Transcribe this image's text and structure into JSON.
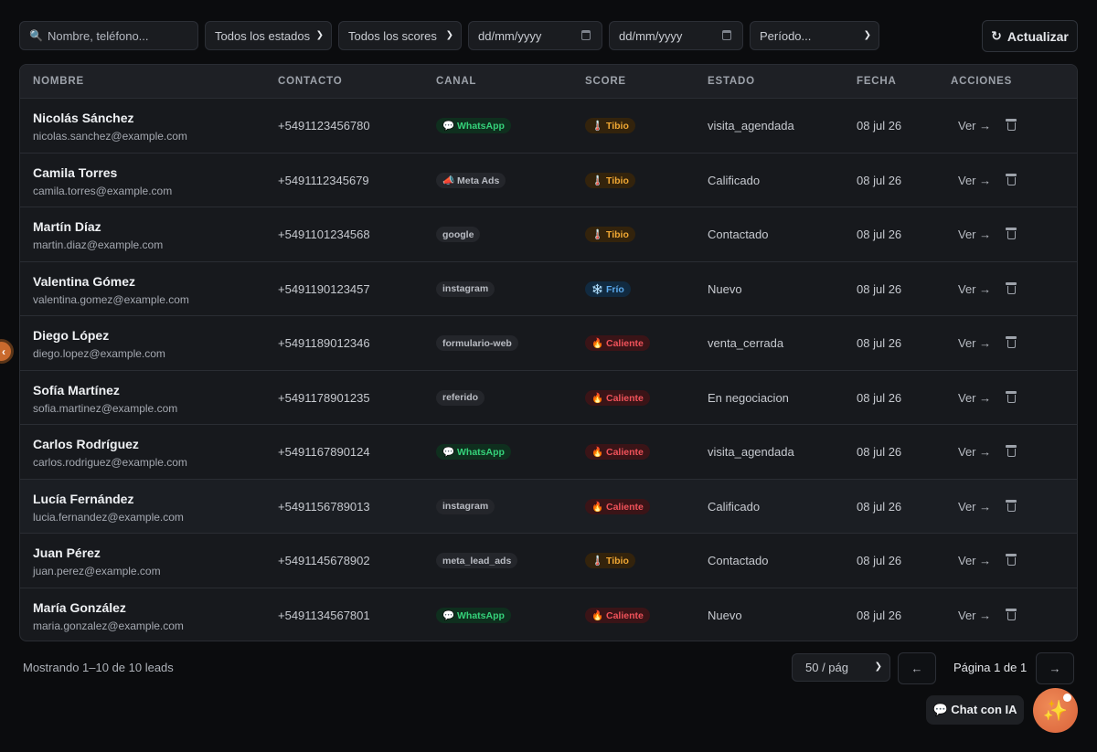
{
  "filters": {
    "search_placeholder": "Nombre, teléfono...",
    "estado": "Todos los estados",
    "score": "Todos los scores",
    "date_from_placeholder": "dd/mm/yyyy",
    "date_to_placeholder": "dd/mm/yyyy",
    "periodo": "Período...",
    "refresh_label": "Actualizar"
  },
  "table": {
    "headers": {
      "nombre": "NOMBRE",
      "contacto": "CONTACTO",
      "canal": "CANAL",
      "score": "SCORE",
      "estado": "ESTADO",
      "fecha": "FECHA",
      "acciones": "ACCIONES"
    },
    "rows": [
      {
        "name": "Nicolás Sánchez",
        "email": "nicolas.sanchez@example.com",
        "phone": "+5491123456780",
        "canal": "💬 WhatsApp",
        "canal_type": "wa",
        "score": "🌡️ Tibio",
        "score_type": "tibio",
        "estado": "visita_agendada",
        "fecha": "08 jul 26",
        "ver": "Ver →"
      },
      {
        "name": "Camila Torres",
        "email": "camila.torres@example.com",
        "phone": "+5491112345679",
        "canal": "📣 Meta Ads",
        "canal_type": "meta",
        "score": "🌡️ Tibio",
        "score_type": "tibio",
        "estado": "Calificado",
        "fecha": "08 jul 26",
        "ver": "Ver →"
      },
      {
        "name": "Martín Díaz",
        "email": "martin.diaz@example.com",
        "phone": "+5491101234568",
        "canal": "google",
        "canal_type": "plain",
        "score": "🌡️ Tibio",
        "score_type": "tibio",
        "estado": "Contactado",
        "fecha": "08 jul 26",
        "ver": "Ver →"
      },
      {
        "name": "Valentina Gómez",
        "email": "valentina.gomez@example.com",
        "phone": "+5491190123457",
        "canal": "instagram",
        "canal_type": "plain",
        "score": "❄️ Frío",
        "score_type": "frio",
        "estado": "Nuevo",
        "fecha": "08 jul 26",
        "ver": "Ver →"
      },
      {
        "name": "Diego López",
        "email": "diego.lopez@example.com",
        "phone": "+5491189012346",
        "canal": "formulario-web",
        "canal_type": "plain",
        "score": "🔥 Caliente",
        "score_type": "caliente",
        "estado": "venta_cerrada",
        "fecha": "08 jul 26",
        "ver": "Ver →"
      },
      {
        "name": "Sofía Martínez",
        "email": "sofia.martinez@example.com",
        "phone": "+5491178901235",
        "canal": "referido",
        "canal_type": "plain",
        "score": "🔥 Caliente",
        "score_type": "caliente",
        "estado": "En negociacion",
        "fecha": "08 jul 26",
        "ver": "Ver →"
      },
      {
        "name": "Carlos Rodríguez",
        "email": "carlos.rodriguez@example.com",
        "phone": "+5491167890124",
        "canal": "💬 WhatsApp",
        "canal_type": "wa",
        "score": "🔥 Caliente",
        "score_type": "caliente",
        "estado": "visita_agendada",
        "fecha": "08 jul 26",
        "ver": "Ver →"
      },
      {
        "name": "Lucía Fernández",
        "email": "lucia.fernandez@example.com",
        "phone": "+5491156789013",
        "canal": "instagram",
        "canal_type": "plain",
        "score": "🔥 Caliente",
        "score_type": "caliente",
        "estado": "Calificado",
        "fecha": "08 jul 26",
        "ver": "Ver →"
      },
      {
        "name": "Juan Pérez",
        "email": "juan.perez@example.com",
        "phone": "+5491145678902",
        "canal": "meta_lead_ads",
        "canal_type": "plain",
        "score": "🌡️ Tibio",
        "score_type": "tibio",
        "estado": "Contactado",
        "fecha": "08 jul 26",
        "ver": "Ver →"
      },
      {
        "name": "María González",
        "email": "maria.gonzalez@example.com",
        "phone": "+5491134567801",
        "canal": "💬 WhatsApp",
        "canal_type": "wa",
        "score": "🔥 Caliente",
        "score_type": "caliente",
        "estado": "Nuevo",
        "fecha": "08 jul 26",
        "ver": "Ver →"
      }
    ]
  },
  "footer": {
    "showing": "Mostrando 1–10 de 10 leads",
    "per_page": "50 / pág",
    "prev": "←",
    "next": "→",
    "page_label": "Página 1 de 1"
  },
  "chat": {
    "label": "💬 Chat con IA",
    "fab_icon": "✨",
    "side_toggle": "‹"
  },
  "icons": {
    "search": "search-icon",
    "refresh": "refresh-icon",
    "calendar": "calendar-icon",
    "delete": "trash-icon"
  }
}
